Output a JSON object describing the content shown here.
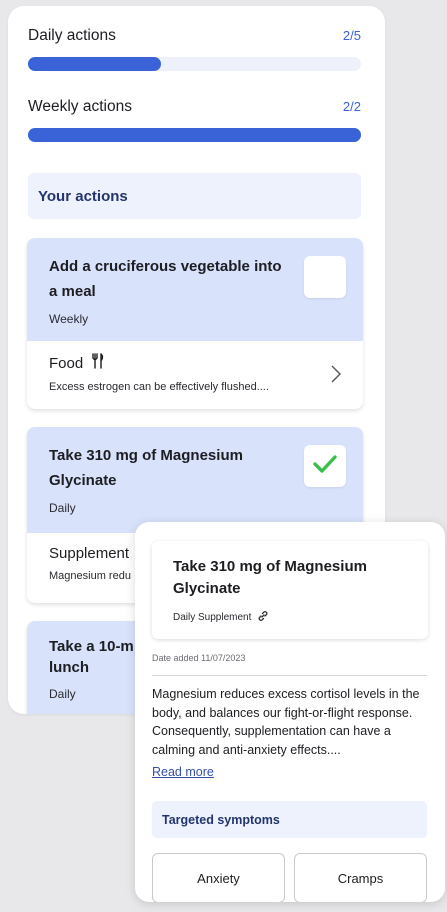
{
  "progress": {
    "daily": {
      "label": "Daily actions",
      "count": "2/5",
      "fraction": 0.4
    },
    "weekly": {
      "label": "Weekly actions",
      "count": "2/2",
      "fraction": 1.0
    }
  },
  "your_actions_label": "Your actions",
  "actions": [
    {
      "title": "Add a cruciferous vegetable into a meal",
      "frequency": "Weekly",
      "checked": false,
      "category": "Food",
      "category_icon": "utensils-icon",
      "description": "Excess estrogen can be effectively flushed...."
    },
    {
      "title": "Take 310 mg of Magnesium Glycinate",
      "frequency": "Daily",
      "checked": true,
      "category": "Supplement",
      "description": "Magnesium redu"
    },
    {
      "title": "Take a 10-m lunch",
      "frequency": "Daily"
    }
  ],
  "detail": {
    "title": "Take 310 mg of Magnesium Glycinate",
    "subtitle": "Daily Supplement",
    "subtitle_icon": "link-icon",
    "date_added": "Date added 11/07/2023",
    "body": "Magnesium reduces excess cortisol levels in the body, and balances our fight-or-flight response. Consequently, supplementation can have a calming and anti-anxiety effects....",
    "read_more": "Read more",
    "targeted_symptoms_label": "Targeted symptoms",
    "symptoms": [
      "Anxiety",
      "Cramps"
    ]
  },
  "colors": {
    "accent": "#3a63d8",
    "card_highlight": "#d8e2fb",
    "check": "#3cbf4a"
  }
}
